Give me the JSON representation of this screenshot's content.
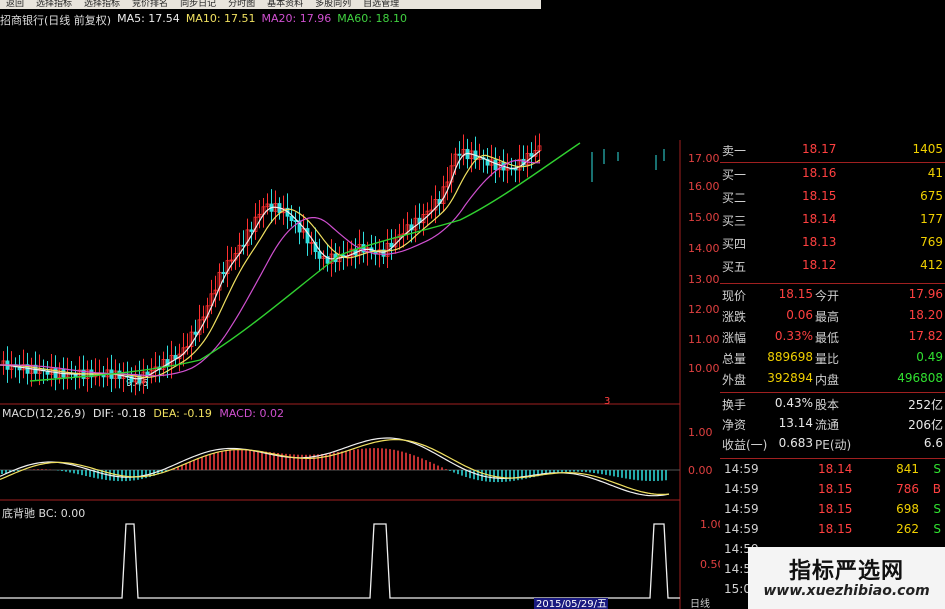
{
  "menu": {
    "items": [
      "返回",
      "选择指标",
      "选择指标",
      "竞价排名",
      "同步日记",
      "分时图",
      "基本资料",
      "多股同列",
      "自选管理"
    ]
  },
  "header": {
    "stock_name": "招商银行(日线 前复权)",
    "ma5": "MA5: 17.54",
    "ma10": "MA10: 17.51",
    "ma20": "MA20: 17.96",
    "ma60": "MA60: 18.10"
  },
  "colors": {
    "up": "#ff3030",
    "down": "#30e0e0",
    "ma5": "#f0f0f0",
    "ma10": "#f0e060",
    "ma20": "#d050d0",
    "ma60": "#30d030",
    "axis_line": "#a02020"
  },
  "price_axis": [
    "17.00",
    "16.00",
    "15.00",
    "14.00",
    "13.00",
    "12.00",
    "11.00",
    "10.00"
  ],
  "low_label": "9.46",
  "marker_label": "3",
  "macd": {
    "label": "MACD(12,26,9)",
    "dif": "DIF: -0.18",
    "dea": "DEA: -0.19",
    "macd": "MACD: 0.02",
    "axis": [
      "1.00",
      "0.00"
    ]
  },
  "bc": {
    "label": "底背驰 BC: 0.00",
    "axis": [
      "1.00",
      "0.50"
    ]
  },
  "bottom_axis": {
    "date": "2015/05/29/五",
    "unit": "日线"
  },
  "quotes": {
    "sell_top": [
      {
        "label": "卖一",
        "price": "18.17",
        "vol": "1405"
      }
    ],
    "buy": [
      {
        "label": "买一",
        "price": "18.16",
        "vol": "41"
      },
      {
        "label": "买二",
        "price": "18.15",
        "vol": "675"
      },
      {
        "label": "买三",
        "price": "18.14",
        "vol": "177"
      },
      {
        "label": "买四",
        "price": "18.13",
        "vol": "769"
      },
      {
        "label": "买五",
        "price": "18.12",
        "vol": "412"
      }
    ],
    "stats": [
      {
        "l1": "现价",
        "v1": "18.15",
        "l2": "今开",
        "v2": "17.96"
      },
      {
        "l1": "涨跌",
        "v1": "0.06",
        "l2": "最高",
        "v2": "18.20"
      },
      {
        "l1": "涨幅",
        "v1": "0.33%",
        "l2": "最低",
        "v2": "17.82"
      },
      {
        "l1": "总量",
        "v1": "889698",
        "l2": "量比",
        "v2": "0.49"
      },
      {
        "l1": "外盘",
        "v1": "392894",
        "l2": "内盘",
        "v2": "496808"
      }
    ],
    "fund": [
      {
        "l1": "换手",
        "v1": "0.43%",
        "l2": "股本",
        "v2": "252亿"
      },
      {
        "l1": "净资",
        "v1": "13.14",
        "l2": "流通",
        "v2": "206亿"
      },
      {
        "l1": "收益(一)",
        "v1": "0.683",
        "l2": "PE(动)",
        "v2": "6.6"
      }
    ],
    "ticks": [
      {
        "time": "14:59",
        "price": "18.14",
        "vol": "841",
        "side": "S"
      },
      {
        "time": "14:59",
        "price": "18.15",
        "vol": "786",
        "side": "B"
      },
      {
        "time": "14:59",
        "price": "18.15",
        "vol": "698",
        "side": "S"
      },
      {
        "time": "14:59",
        "price": "18.15",
        "vol": "262",
        "side": "S"
      },
      {
        "time": "14:59",
        "price": "",
        "vol": "",
        "side": ""
      },
      {
        "time": "14:59",
        "price": "",
        "vol": "",
        "side": ""
      },
      {
        "time": "15:00",
        "price": "",
        "vol": "",
        "side": ""
      }
    ]
  },
  "watermark": {
    "title": "指标严选网",
    "url": "www.xuezhibiao.com"
  }
}
